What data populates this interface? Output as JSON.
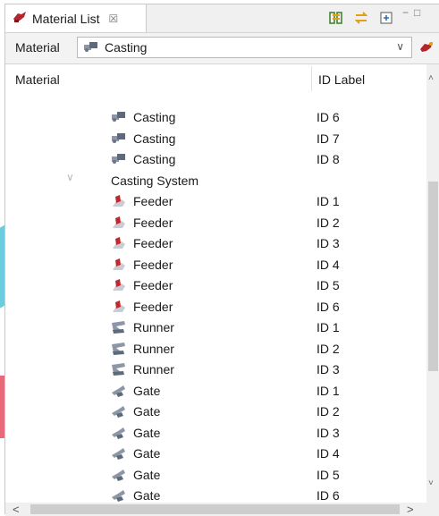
{
  "tab": {
    "title": "Material List",
    "close_glyph": "☒"
  },
  "window_controls": {
    "minimize": "−",
    "maximize": "□"
  },
  "toolbar": {
    "icons": [
      "link-columns-icon",
      "swap-arrows-icon",
      "expand-all-icon"
    ]
  },
  "selector": {
    "label": "Material",
    "value": "Casting",
    "icon": "casting-icon",
    "arrow": "∨"
  },
  "table": {
    "columns": [
      "Material",
      "ID Label"
    ],
    "rows": [
      {
        "type": "item",
        "icon": "casting",
        "name": "Casting",
        "id": "ID 6"
      },
      {
        "type": "item",
        "icon": "casting",
        "name": "Casting",
        "id": "ID 7"
      },
      {
        "type": "item",
        "icon": "casting",
        "name": "Casting",
        "id": "ID 8"
      },
      {
        "type": "group",
        "name": "Casting System",
        "id": ""
      },
      {
        "type": "item",
        "icon": "feeder",
        "name": "Feeder",
        "id": "ID 1"
      },
      {
        "type": "item",
        "icon": "feeder",
        "name": "Feeder",
        "id": "ID 2"
      },
      {
        "type": "item",
        "icon": "feeder",
        "name": "Feeder",
        "id": "ID 3"
      },
      {
        "type": "item",
        "icon": "feeder",
        "name": "Feeder",
        "id": "ID 4"
      },
      {
        "type": "item",
        "icon": "feeder",
        "name": "Feeder",
        "id": "ID 5"
      },
      {
        "type": "item",
        "icon": "feeder",
        "name": "Feeder",
        "id": "ID 6"
      },
      {
        "type": "item",
        "icon": "runner",
        "name": "Runner",
        "id": "ID 1"
      },
      {
        "type": "item",
        "icon": "runner",
        "name": "Runner",
        "id": "ID 2"
      },
      {
        "type": "item",
        "icon": "runner",
        "name": "Runner",
        "id": "ID 3"
      },
      {
        "type": "item",
        "icon": "gate",
        "name": "Gate",
        "id": "ID 1"
      },
      {
        "type": "item",
        "icon": "gate",
        "name": "Gate",
        "id": "ID 2"
      },
      {
        "type": "item",
        "icon": "gate",
        "name": "Gate",
        "id": "ID 3"
      },
      {
        "type": "item",
        "icon": "gate",
        "name": "Gate",
        "id": "ID 4"
      },
      {
        "type": "item",
        "icon": "gate",
        "name": "Gate",
        "id": "ID 5"
      },
      {
        "type": "item",
        "icon": "gate",
        "name": "Gate",
        "id": "ID 6"
      }
    ]
  },
  "scroll": {
    "up": "˄",
    "down": "˅",
    "left": "<",
    "right": ">"
  },
  "colors": {
    "accent_red": "#c0282d",
    "selection_blue": "#5bc6dd",
    "deco_red": "#e35a6b"
  }
}
